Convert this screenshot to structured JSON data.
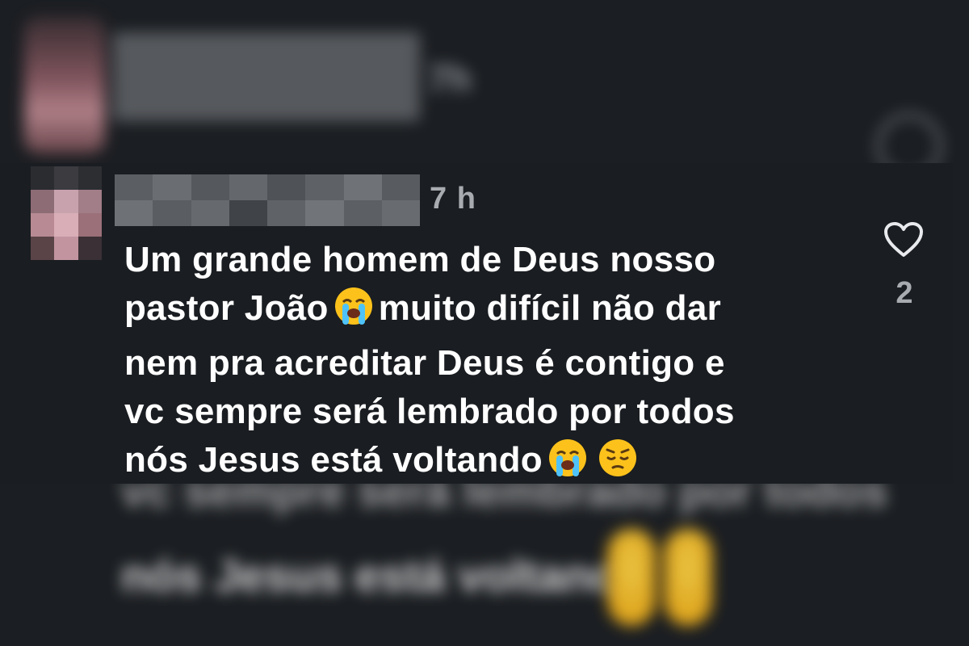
{
  "background": {
    "time": "7h",
    "text_line_a": "vc sempre será lembrado por todos",
    "text_line_b": "nós Jesus está voltando"
  },
  "comment": {
    "timestamp": "7 h",
    "text_lines": [
      "Um grande homem de Deus nosso",
      "pastor João",
      "muito difícil não dar",
      "nem pra acreditar Deus é contigo e",
      "vc sempre será lembrado por todos",
      "nós Jesus está voltando"
    ],
    "like_count": "2",
    "icons": {
      "like": "heart-outline-icon",
      "emoji_1": "loudly-crying-face-emoji",
      "emoji_2": "loudly-crying-face-emoji",
      "emoji_3": "pensive-face-emoji"
    }
  },
  "colors": {
    "background": "#1a1d21",
    "text": "#ffffff",
    "muted": "#a8acb1"
  }
}
